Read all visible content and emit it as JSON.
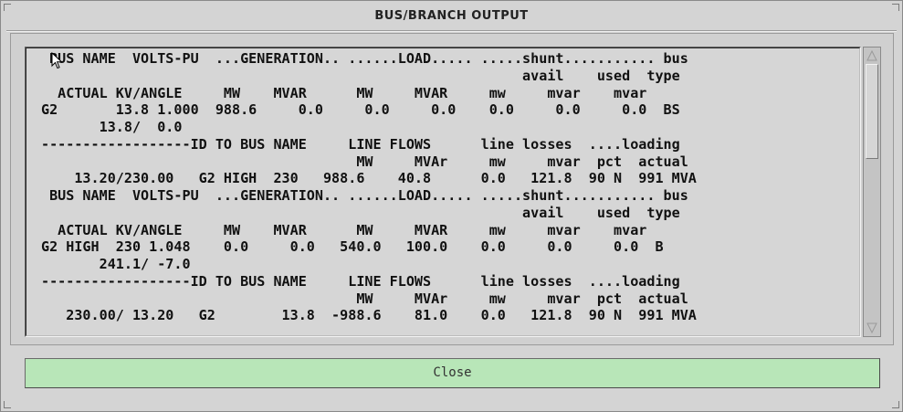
{
  "window": {
    "title": "BUS/BRANCH OUTPUT"
  },
  "report": {
    "lines": [
      " BUS NAME  VOLTS-PU  ...GENERATION.. ......LOAD..... .....shunt........... bus",
      "                                                          avail    used  type",
      "  ACTUAL KV/ANGLE     MW    MVAR      MW     MVAR     mw     mvar    mvar",
      "G2       13.8 1.000  988.6     0.0     0.0     0.0    0.0     0.0     0.0  BS",
      "       13.8/  0.0",
      "------------------ID TO BUS NAME     LINE FLOWS      line losses  ....loading",
      "                                      MW     MVAr     mw     mvar  pct  actual",
      "    13.20/230.00   G2 HIGH  230   988.6    40.8      0.0   121.8  90 N  991 MVA",
      " BUS NAME  VOLTS-PU  ...GENERATION.. ......LOAD..... .....shunt........... bus",
      "                                                          avail    used  type",
      "  ACTUAL KV/ANGLE     MW    MVAR      MW     MVAR     mw     mvar    mvar",
      "G2 HIGH  230 1.048    0.0     0.0   540.0   100.0    0.0     0.0     0.0  B",
      "       241.1/ -7.0",
      "------------------ID TO BUS NAME     LINE FLOWS      line losses  ....loading",
      "                                      MW     MVAr     mw     mvar  pct  actual",
      "   230.00/ 13.20   G2        13.8  -988.6    81.0    0.0   121.8  90 N  991 MVA"
    ]
  },
  "buttons": {
    "close_label": "Close"
  },
  "icons": {
    "scroll_up": "scroll-up-arrow-icon",
    "scroll_down": "scroll-down-arrow-icon",
    "cursor": "mouse-pointer-icon"
  },
  "colors": {
    "close_button_bg": "#b8e6b8",
    "window_bg": "#d4d4d4"
  }
}
